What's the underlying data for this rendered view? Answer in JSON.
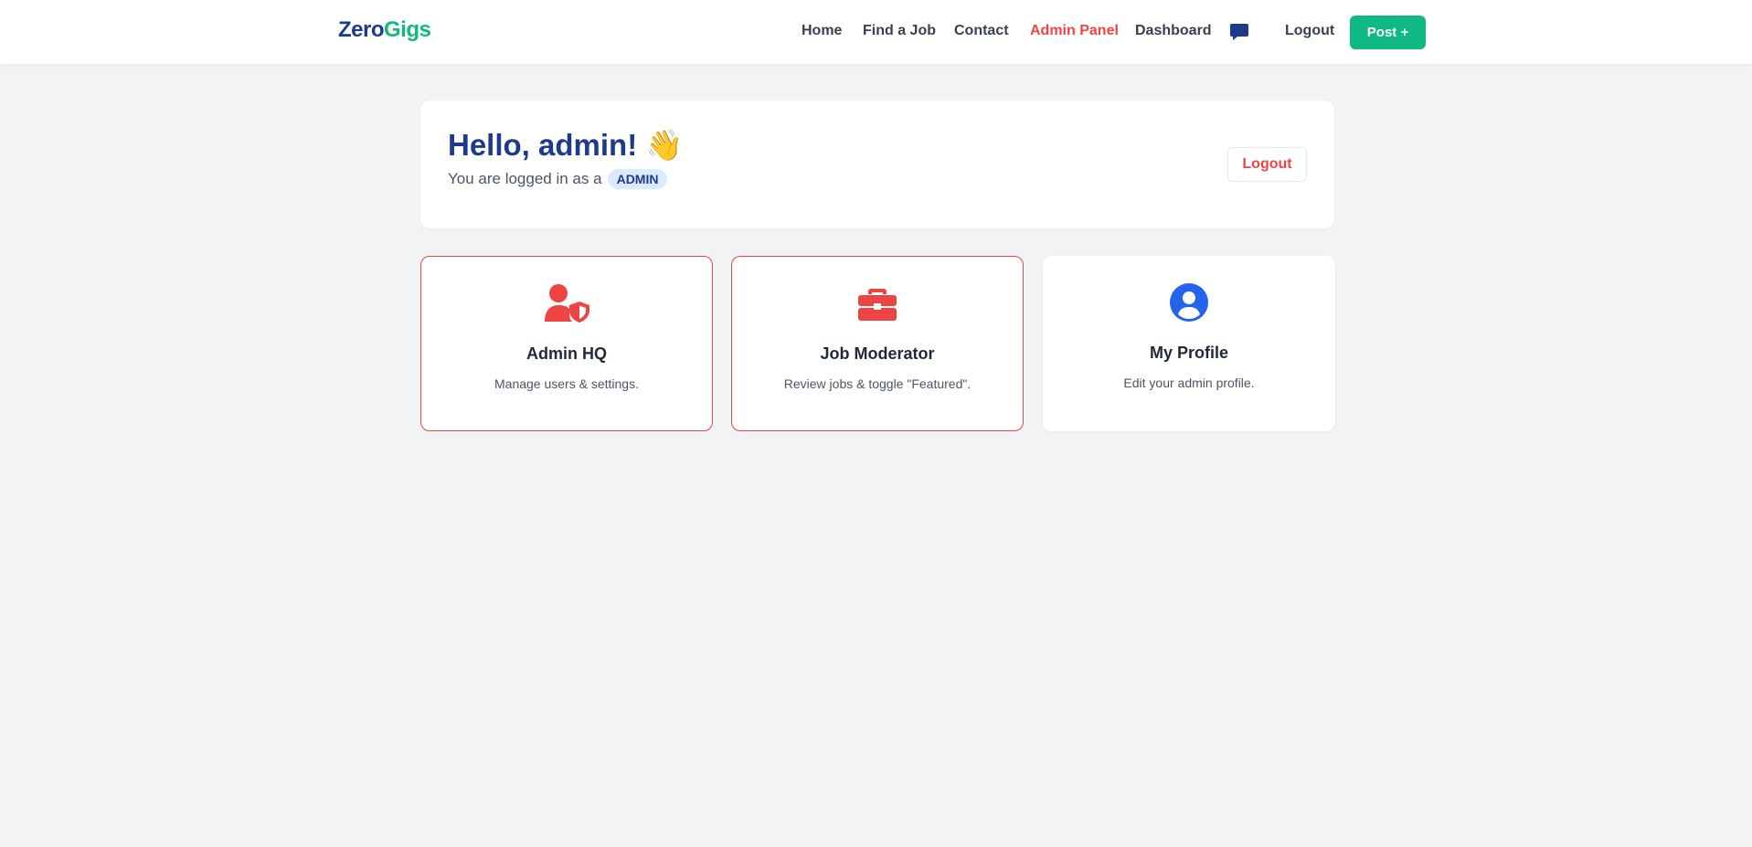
{
  "brand": {
    "part1": "Zero",
    "part2": "Gigs"
  },
  "nav": {
    "home": "Home",
    "find_job": "Find a Job",
    "contact": "Contact",
    "admin_panel": "Admin Panel",
    "dashboard": "Dashboard",
    "messages_icon": "chat-bubble-icon",
    "logout": "Logout",
    "post": "Post +"
  },
  "welcome": {
    "greeting": "Hello, admin! 👋",
    "logged_prefix": "You are logged in as a",
    "role": "ADMIN",
    "logout": "Logout"
  },
  "cards": [
    {
      "title": "Admin HQ",
      "desc": "Manage users & settings.",
      "icon": "user-shield-icon"
    },
    {
      "title": "Job Moderator",
      "desc": "Review jobs & toggle \"Featured\".",
      "icon": "briefcase-icon"
    },
    {
      "title": "My Profile",
      "desc": "Edit your admin profile.",
      "icon": "user-circle-icon"
    }
  ],
  "colors": {
    "brand_navy": "#1e3a8a",
    "brand_green": "#10b981",
    "accent_red": "#ef4444",
    "accent_blue": "#2563eb",
    "background": "#f2f3f5"
  }
}
